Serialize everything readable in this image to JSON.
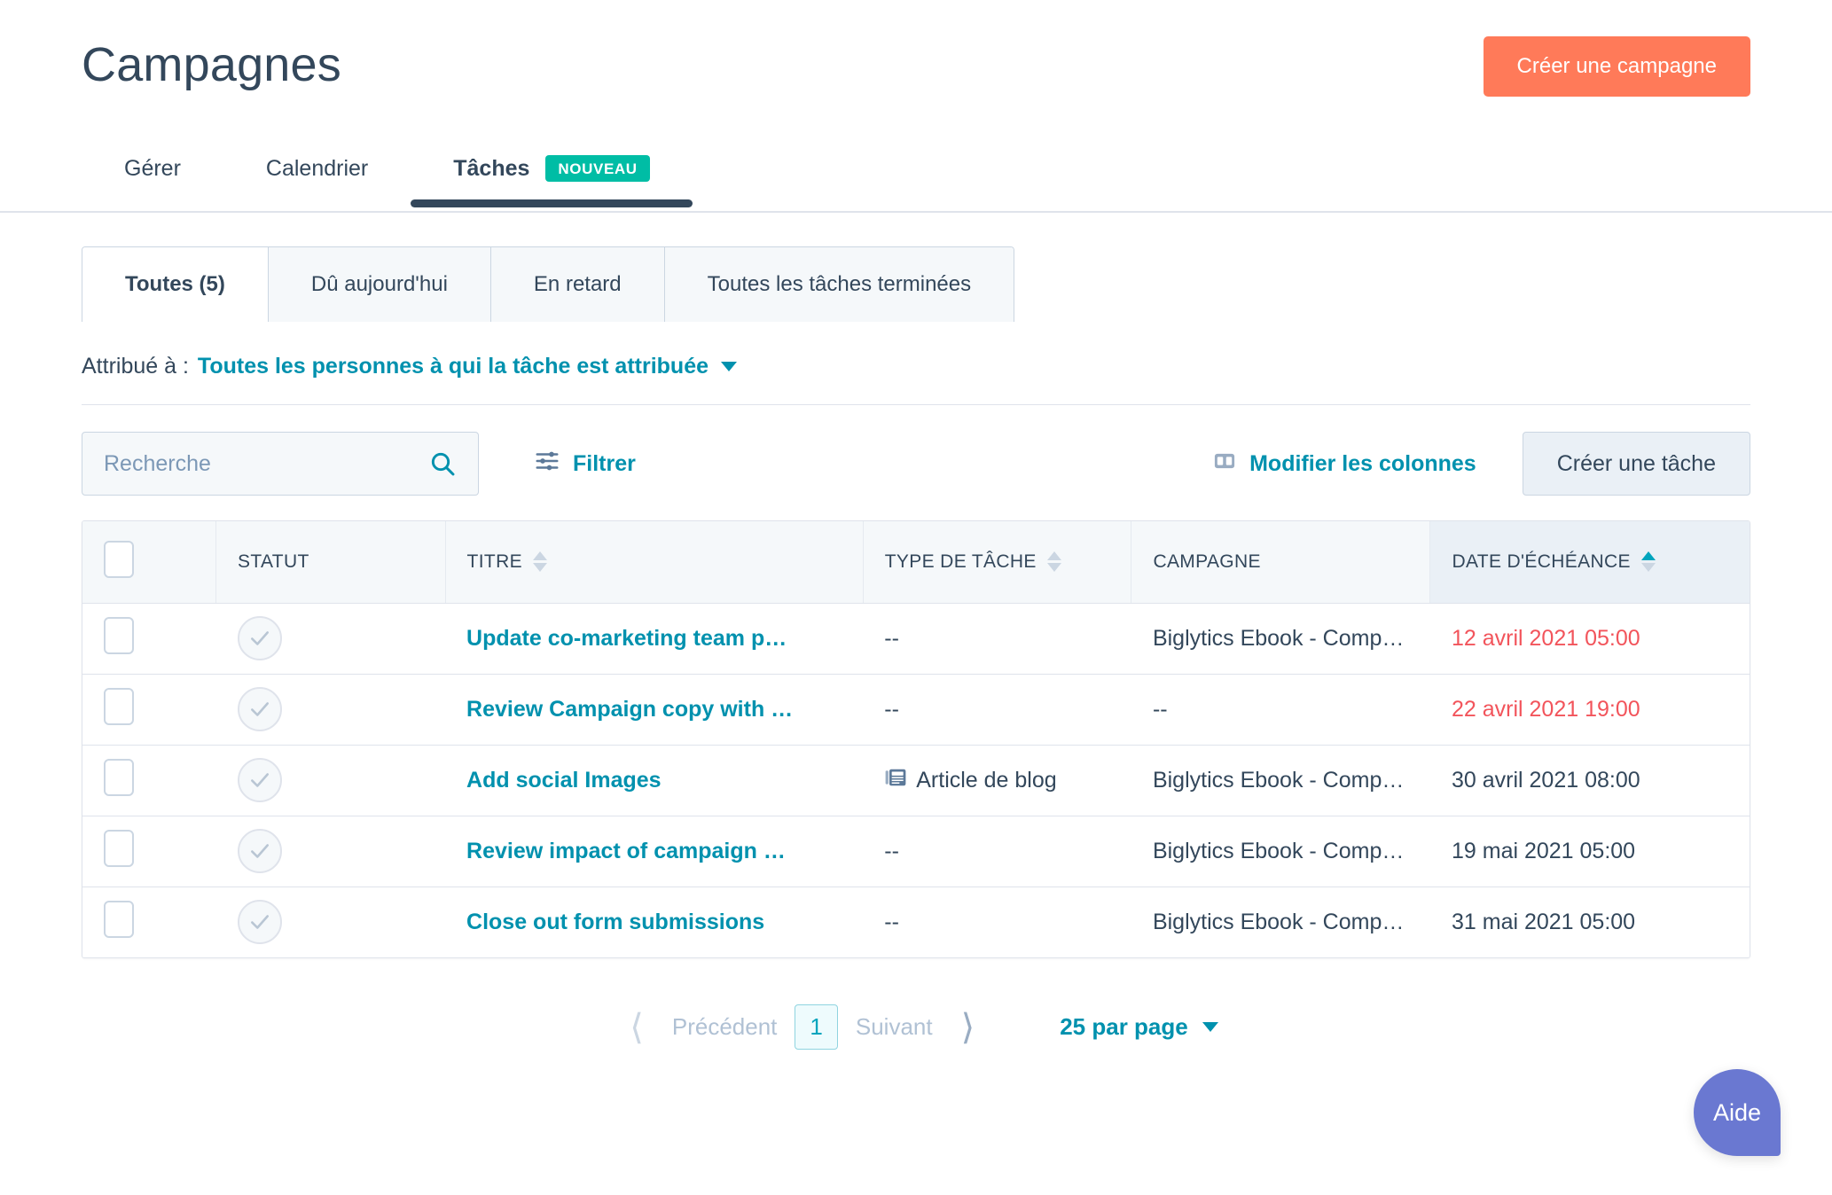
{
  "header": {
    "title": "Campagnes",
    "cta_label": "Créer une campagne",
    "nav": [
      {
        "label": "Gérer",
        "active": false
      },
      {
        "label": "Calendrier",
        "active": false
      },
      {
        "label": "Tâches",
        "active": true,
        "badge": "NOUVEAU"
      }
    ]
  },
  "subtabs": [
    {
      "label": "Toutes (5)",
      "active": true
    },
    {
      "label": "Dû aujourd'hui",
      "active": false
    },
    {
      "label": "En retard",
      "active": false
    },
    {
      "label": "Toutes les tâches terminées",
      "active": false
    }
  ],
  "assigned": {
    "label": "Attribué à :",
    "value": "Toutes les personnes à qui la tâche est attribuée"
  },
  "toolbar": {
    "search_placeholder": "Recherche",
    "search_value": "",
    "filter_label": "Filtrer",
    "edit_columns_label": "Modifier les colonnes",
    "create_task_label": "Créer une tâche"
  },
  "table": {
    "columns": [
      {
        "label": "",
        "sortable": false
      },
      {
        "label": "STATUT",
        "sortable": false
      },
      {
        "label": "TITRE",
        "sortable": true,
        "sorted": false
      },
      {
        "label": "TYPE DE TÂCHE",
        "sortable": true,
        "sorted": false
      },
      {
        "label": "CAMPAGNE",
        "sortable": false
      },
      {
        "label": "DATE D'ÉCHÉANCE",
        "sortable": true,
        "sorted": true,
        "direction": "asc"
      }
    ],
    "rows": [
      {
        "title": "Update co-marketing team p…",
        "type": "--",
        "type_icon": null,
        "campaign": "Biglytics Ebook - Compe…",
        "due": "12 avril 2021 05:00",
        "overdue": true
      },
      {
        "title": "Review Campaign copy with …",
        "type": "--",
        "type_icon": null,
        "campaign": "--",
        "due": "22 avril 2021 19:00",
        "overdue": true
      },
      {
        "title": "Add social Images",
        "type": "Article de blog",
        "type_icon": "article-icon",
        "campaign": "Biglytics Ebook - Compe…",
        "due": "30 avril 2021 08:00",
        "overdue": false
      },
      {
        "title": "Review impact of campaign …",
        "type": "--",
        "type_icon": null,
        "campaign": "Biglytics Ebook - Compe…",
        "due": "19 mai 2021 05:00",
        "overdue": false
      },
      {
        "title": "Close out form submissions",
        "type": "--",
        "type_icon": null,
        "campaign": "Biglytics Ebook - Compe…",
        "due": "31 mai 2021 05:00",
        "overdue": false
      }
    ]
  },
  "pagination": {
    "prev_label": "Précédent",
    "page_number": "1",
    "next_label": "Suivant",
    "per_page_label": "25 par page"
  },
  "help": {
    "label": "Aide"
  },
  "colors": {
    "brand_orange": "#ff7a59",
    "teal_link": "#0091ae",
    "teal_badge": "#00bda5",
    "navy_text": "#33475b",
    "overdue_red": "#f2545b",
    "help_purple": "#6a78d1",
    "panel_bg": "#f5f8fa",
    "border": "#dfe3eb"
  }
}
